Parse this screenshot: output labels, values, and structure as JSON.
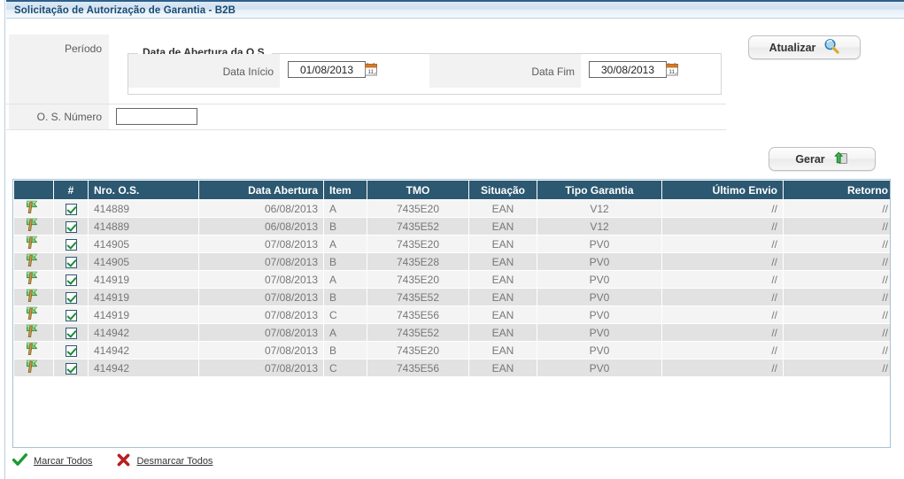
{
  "window": {
    "title": "Solicitação de Autorização de Garantia - B2B"
  },
  "filters": {
    "periodo_label": "Período",
    "os_numero_label": "O. S. Número",
    "os_numero_value": "",
    "os_numero_placeholder": "",
    "fieldset_legend": "Data de Abertura da O.S.",
    "data_inicio_label": "Data Início",
    "data_inicio_value": "01/08/2013",
    "data_fim_label": "Data Fim",
    "data_fim_value": "30/08/2013"
  },
  "toolbar": {
    "atualizar_label": "Atualizar",
    "atualizar_icon": "search-magnifier-icon",
    "gerar_label": "Gerar",
    "gerar_icon": "green-up-arrow-box-icon"
  },
  "grid": {
    "columns": [
      {
        "key": "flag",
        "label": "",
        "align": "center"
      },
      {
        "key": "check",
        "label": "#",
        "align": "center"
      },
      {
        "key": "nro_os",
        "label": "Nro. O.S.",
        "align": "left"
      },
      {
        "key": "data",
        "label": "Data Abertura",
        "align": "right"
      },
      {
        "key": "item",
        "label": "Item",
        "align": "left"
      },
      {
        "key": "tmo",
        "label": "TMO",
        "align": "center"
      },
      {
        "key": "situacao",
        "label": "Situação",
        "align": "center"
      },
      {
        "key": "tipo",
        "label": "Tipo Garantia",
        "align": "center"
      },
      {
        "key": "ultimo",
        "label": "Último Envio",
        "align": "right"
      },
      {
        "key": "retorno",
        "label": "Retorno",
        "align": "right"
      }
    ],
    "rows": [
      {
        "checked": true,
        "nro_os": "414889",
        "data": "06/08/2013",
        "item": "A",
        "tmo": "7435E20",
        "situacao": "EAN",
        "tipo": "V12",
        "ultimo": "//",
        "retorno": "//"
      },
      {
        "checked": true,
        "nro_os": "414889",
        "data": "06/08/2013",
        "item": "B",
        "tmo": "7435E52",
        "situacao": "EAN",
        "tipo": "V12",
        "ultimo": "//",
        "retorno": "//"
      },
      {
        "checked": true,
        "nro_os": "414905",
        "data": "07/08/2013",
        "item": "A",
        "tmo": "7435E20",
        "situacao": "EAN",
        "tipo": "PV0",
        "ultimo": "//",
        "retorno": "//"
      },
      {
        "checked": true,
        "nro_os": "414905",
        "data": "07/08/2013",
        "item": "B",
        "tmo": "7435E28",
        "situacao": "EAN",
        "tipo": "PV0",
        "ultimo": "//",
        "retorno": "//"
      },
      {
        "checked": true,
        "nro_os": "414919",
        "data": "07/08/2013",
        "item": "A",
        "tmo": "7435E20",
        "situacao": "EAN",
        "tipo": "PV0",
        "ultimo": "//",
        "retorno": "//"
      },
      {
        "checked": true,
        "nro_os": "414919",
        "data": "07/08/2013",
        "item": "B",
        "tmo": "7435E52",
        "situacao": "EAN",
        "tipo": "PV0",
        "ultimo": "//",
        "retorno": "//"
      },
      {
        "checked": true,
        "nro_os": "414919",
        "data": "07/08/2013",
        "item": "C",
        "tmo": "7435E56",
        "situacao": "EAN",
        "tipo": "PV0",
        "ultimo": "//",
        "retorno": "//"
      },
      {
        "checked": true,
        "nro_os": "414942",
        "data": "07/08/2013",
        "item": "A",
        "tmo": "7435E52",
        "situacao": "EAN",
        "tipo": "PV0",
        "ultimo": "//",
        "retorno": "//"
      },
      {
        "checked": true,
        "nro_os": "414942",
        "data": "07/08/2013",
        "item": "B",
        "tmo": "7435E20",
        "situacao": "EAN",
        "tipo": "PV0",
        "ultimo": "//",
        "retorno": "//"
      },
      {
        "checked": true,
        "nro_os": "414942",
        "data": "07/08/2013",
        "item": "C",
        "tmo": "7435E56",
        "situacao": "EAN",
        "tipo": "PV0",
        "ultimo": "//",
        "retorno": "//"
      }
    ]
  },
  "footer": {
    "marcar_todos_label": "Marcar Todos",
    "marcar_todos_icon": "green-check-icon",
    "desmarcar_todos_label": "Desmarcar Todos",
    "desmarcar_todos_icon": "red-x-icon"
  },
  "colors": {
    "title_text": "#174a74",
    "header_bg": "#2c5871",
    "row_bg": "#f4f4f4",
    "row_alt_bg": "#e2e2e2",
    "grid_border": "#a8c2d4",
    "accent_green": "#1d8a3a",
    "accent_red": "#b81f1f"
  }
}
